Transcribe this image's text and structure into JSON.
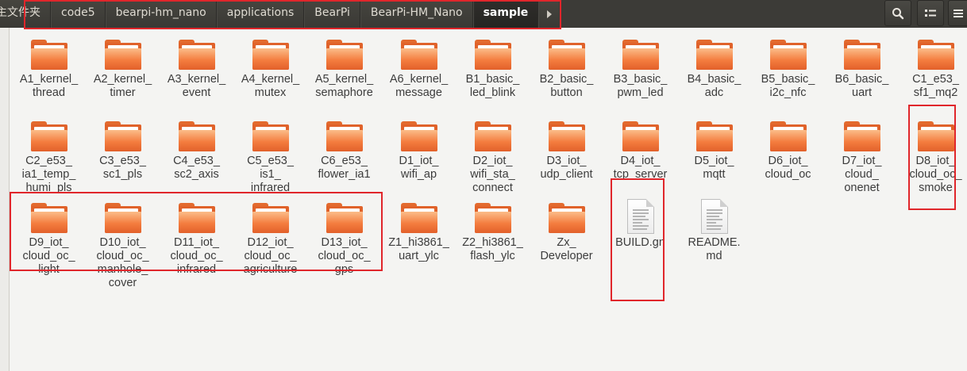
{
  "path_bar": {
    "crumbs": [
      "主文件夹",
      "code5",
      "bearpi-hm_nano",
      "applications",
      "BearPi",
      "BearPi-HM_Nano",
      "sample"
    ],
    "active_index": 6
  },
  "toolbar_icons": [
    "search-icon",
    "list-view-icon",
    "menu-icon"
  ],
  "items": [
    {
      "label": "A1_kernel_\nthread",
      "type": "folder"
    },
    {
      "label": "A2_kernel_\ntimer",
      "type": "folder"
    },
    {
      "label": "A3_kernel_\nevent",
      "type": "folder"
    },
    {
      "label": "A4_kernel_\nmutex",
      "type": "folder"
    },
    {
      "label": "A5_kernel_\nsemaphore",
      "type": "folder"
    },
    {
      "label": "A6_kernel_\nmessage",
      "type": "folder"
    },
    {
      "label": "B1_basic_\nled_blink",
      "type": "folder"
    },
    {
      "label": "B2_basic_\nbutton",
      "type": "folder"
    },
    {
      "label": "B3_basic_\npwm_led",
      "type": "folder"
    },
    {
      "label": "B4_basic_\nadc",
      "type": "folder"
    },
    {
      "label": "B5_basic_\ni2c_nfc",
      "type": "folder"
    },
    {
      "label": "B6_basic_\nuart",
      "type": "folder"
    },
    {
      "label": "C1_e53_\nsf1_mq2",
      "type": "folder"
    },
    {
      "label": "C2_e53_\nia1_temp_\nhumi_pls",
      "type": "folder"
    },
    {
      "label": "C3_e53_\nsc1_pls",
      "type": "folder"
    },
    {
      "label": "C4_e53_\nsc2_axis",
      "type": "folder"
    },
    {
      "label": "C5_e53_\nis1_\ninfrared",
      "type": "folder"
    },
    {
      "label": "C6_e53_\nflower_ia1",
      "type": "folder"
    },
    {
      "label": "D1_iot_\nwifi_ap",
      "type": "folder"
    },
    {
      "label": "D2_iot_\nwifi_sta_\nconnect",
      "type": "folder"
    },
    {
      "label": "D3_iot_\nudp_client",
      "type": "folder"
    },
    {
      "label": "D4_iot_\ntcp_server",
      "type": "folder"
    },
    {
      "label": "D5_iot_\nmqtt",
      "type": "folder"
    },
    {
      "label": "D6_iot_\ncloud_oc",
      "type": "folder"
    },
    {
      "label": "D7_iot_\ncloud_\nonenet",
      "type": "folder"
    },
    {
      "label": "D8_iot_\ncloud_oc_\nsmoke",
      "type": "folder"
    },
    {
      "label": "D9_iot_\ncloud_oc_\nlight",
      "type": "folder"
    },
    {
      "label": "D10_iot_\ncloud_oc_\nmanhole_\ncover",
      "type": "folder"
    },
    {
      "label": "D11_iot_\ncloud_oc_\ninfrared",
      "type": "folder"
    },
    {
      "label": "D12_iot_\ncloud_oc_\nagriculture",
      "type": "folder"
    },
    {
      "label": "D13_iot_\ncloud_oc_\ngps",
      "type": "folder"
    },
    {
      "label": "Z1_hi3861_\nuart_ylc",
      "type": "folder"
    },
    {
      "label": "Z2_hi3861_\nflash_ylc",
      "type": "folder"
    },
    {
      "label": "Zx_\nDeveloper",
      "type": "folder"
    },
    {
      "label": "BUILD.gn",
      "type": "file"
    },
    {
      "label": "README.\nmd",
      "type": "file"
    }
  ],
  "colors": {
    "highlight": "#e0262b",
    "folder_orange": "#f47d3f",
    "toolbar": "#3c3b37"
  }
}
